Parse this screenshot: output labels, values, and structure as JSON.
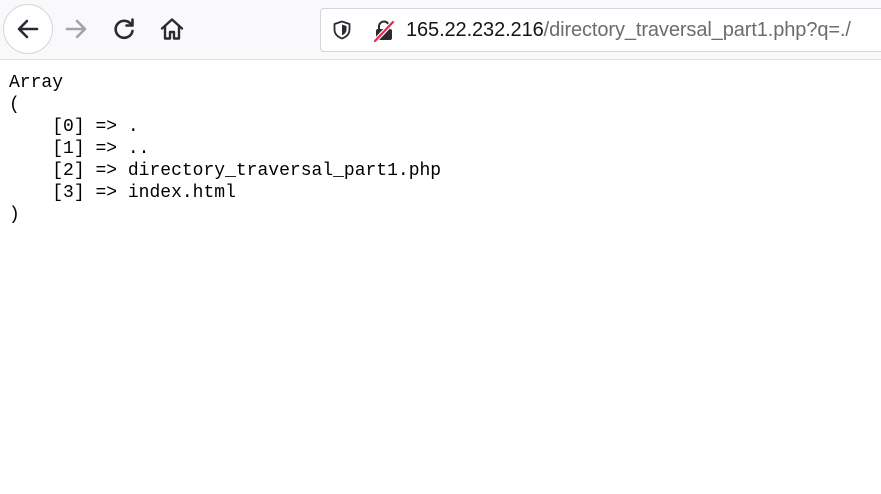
{
  "browser": {
    "url_host": "165.22.232.216",
    "url_path": "/directory_traversal_part1.php?q=./",
    "icons": {
      "back": "arrow-left-icon",
      "forward": "arrow-right-icon",
      "reload": "reload-icon",
      "home": "home-icon",
      "tracking": "shield-icon",
      "insecure": "insecure-lock-icon"
    },
    "colors": {
      "toolbar_bg": "#f9f9fb",
      "insecure_slash": "#e22850"
    }
  },
  "page": {
    "open_line": "Array",
    "open_paren": "(",
    "entries": [
      {
        "key": "[0]",
        "arrow": "=>",
        "value": "."
      },
      {
        "key": "[1]",
        "arrow": "=>",
        "value": ".."
      },
      {
        "key": "[2]",
        "arrow": "=>",
        "value": "directory_traversal_part1.php"
      },
      {
        "key": "[3]",
        "arrow": "=>",
        "value": "index.html"
      }
    ],
    "close_paren": ")"
  }
}
